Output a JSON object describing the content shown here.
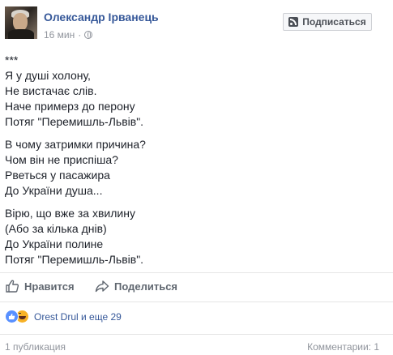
{
  "post": {
    "author": "Олександр Ірванець",
    "time": "16 мин",
    "separator": "·",
    "subscribe_label": "Подписаться",
    "poem": {
      "stanzas": [
        [
          "***",
          "Я у душі холону,",
          "Не вистачає слів.",
          "Наче примерз до перону",
          "Потяг \"Перемишль-Львів\"."
        ],
        [
          "В чому затримки причина?",
          "Чом він не приспіша?",
          "Рветься у пасажира",
          "До України душа..."
        ],
        [
          "Вірю, що вже за хвилину",
          "(Або за кілька днів)",
          "До України полине",
          "Потяг \"Перемишль-Львів\"."
        ]
      ]
    },
    "actions": {
      "like_label": "Нравится",
      "share_label": "Поделиться"
    },
    "reactions": {
      "text": "Orest Drul и еще 29",
      "types": [
        "like-icon",
        "haha-icon"
      ]
    },
    "footer": {
      "shares": "1 публикация",
      "comments": "Комментарии: 1"
    }
  },
  "colors": {
    "link_blue": "#365899",
    "meta_gray": "#90949c",
    "like_blue": "#5890ff",
    "haha_yellow": "#f7b125"
  }
}
